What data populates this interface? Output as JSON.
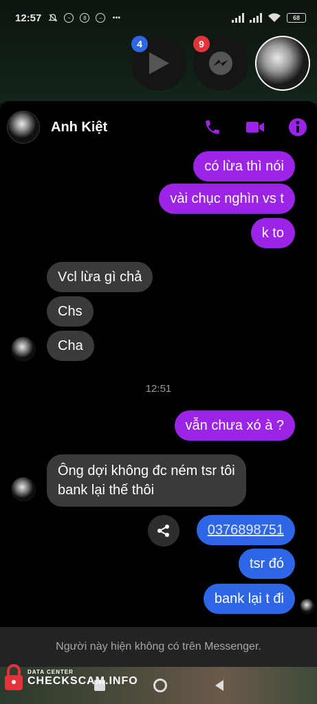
{
  "status_bar": {
    "time": "12:57",
    "battery": "68"
  },
  "chat_heads": {
    "video_badge": "4",
    "messenger_badge": "9"
  },
  "chat": {
    "contact_name": "Anh Kiệt",
    "accent_color": "#9b24e6",
    "messages": [
      {
        "side": "out",
        "text": "có lừa thì nói"
      },
      {
        "side": "out",
        "text": "vài chục nghìn vs t"
      },
      {
        "side": "out",
        "text": "k to"
      },
      {
        "side": "in",
        "text": "Vcl lừa gì chả"
      },
      {
        "side": "in",
        "text": "Chs"
      },
      {
        "side": "in",
        "text": "Cha"
      },
      {
        "side": "out",
        "text": "vẫn chưa xó à ?"
      },
      {
        "side": "in",
        "text": "Ông dợi không đc ném tsr tôi"
      },
      {
        "side": "in",
        "text": "bank lại thế thôi"
      },
      {
        "side": "out",
        "text": "0376898751"
      },
      {
        "side": "out",
        "text": "tsr đó"
      },
      {
        "side": "out",
        "text": "bank lại t đi"
      }
    ],
    "timestamp": "12:51"
  },
  "footer": {
    "notice": "Người này hiện không có trên Messenger."
  },
  "watermark": {
    "top": "DATA CENTER",
    "bottom": "CHECKSCAM.INFO"
  }
}
